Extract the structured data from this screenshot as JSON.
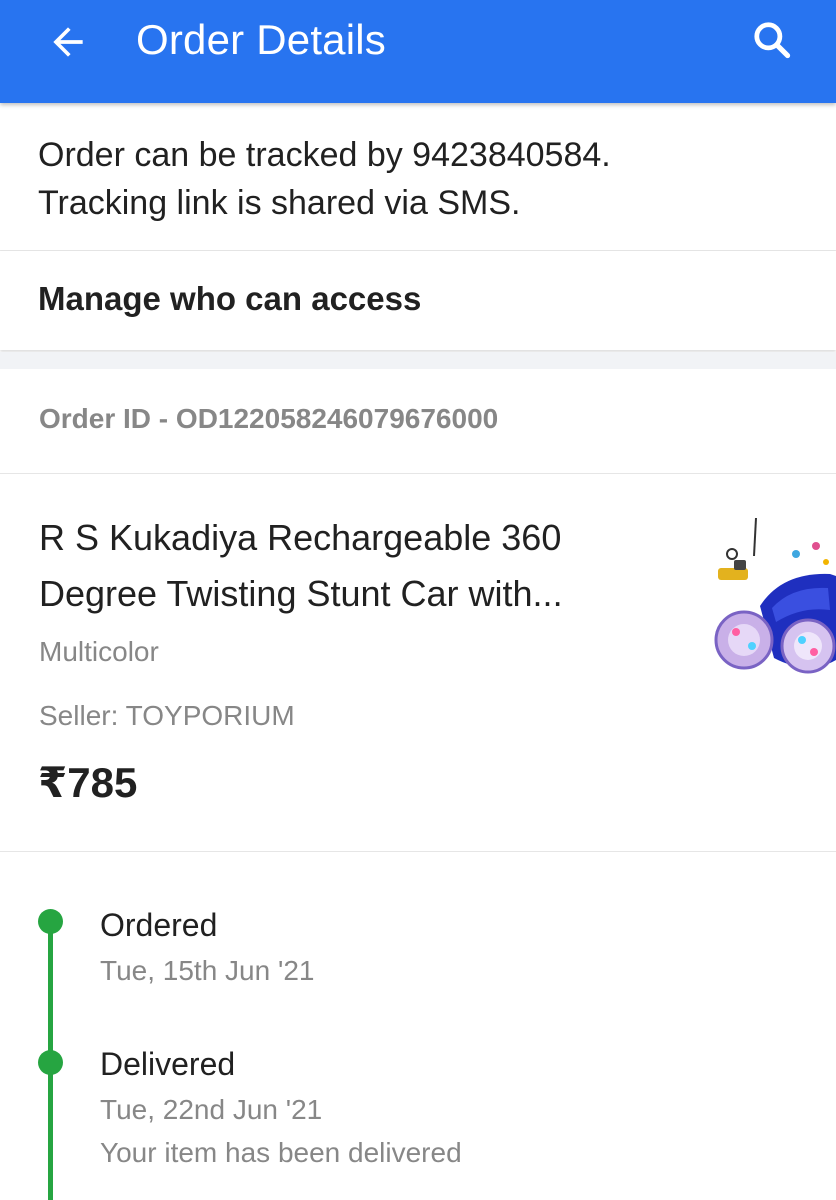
{
  "header": {
    "title": "Order Details",
    "back_icon": "arrow-left-icon",
    "search_icon": "search-icon",
    "background_color": "#2874f0"
  },
  "tracking": {
    "line1": "Order can be tracked by 9423840584.",
    "line2": "Tracking link is shared via SMS."
  },
  "access": {
    "label": "Manage who can access"
  },
  "order": {
    "id_text": "Order ID - OD122058246079676000"
  },
  "product": {
    "title_line1": "R S Kukadiya Rechargeable 360",
    "title_line2": "Degree Twisting Stunt Car with...",
    "variant": "Multicolor",
    "seller": "Seller: TOYPORIUM",
    "price": "₹785",
    "image_icon": "toy-car-image"
  },
  "timeline": {
    "accent_color": "#26a541",
    "events": [
      {
        "status": "Ordered",
        "date": "Tue, 15th Jun '21",
        "note": ""
      },
      {
        "status": "Delivered",
        "date": "Tue, 22nd Jun '21",
        "note": "Your item has been delivered"
      }
    ]
  }
}
